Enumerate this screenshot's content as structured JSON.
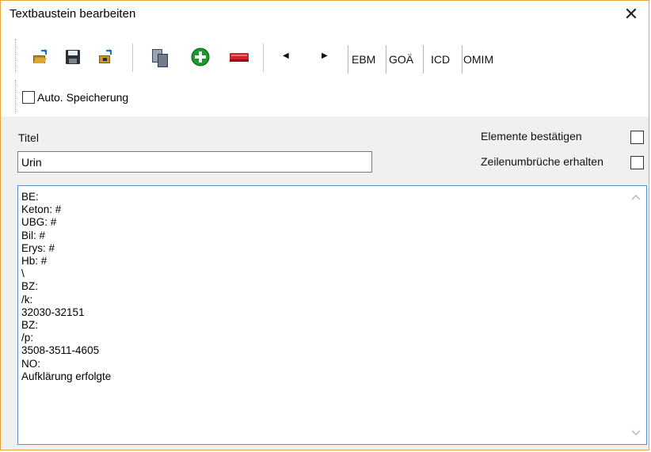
{
  "window": {
    "title": "Textbaustein bearbeiten",
    "close_glyph": "✕"
  },
  "toolbar": {
    "icons": [
      "open-folder-icon",
      "save-icon",
      "export-folder-icon",
      "copy-icon",
      "add-icon",
      "remove-icon"
    ],
    "nav_prev": "◀",
    "nav_next": "▶",
    "labels": [
      "EBM",
      "GOÄ",
      "ICD",
      "OMIM"
    ],
    "auto_save_label": "Auto. Speicherung",
    "auto_save_checked": false
  },
  "form": {
    "title_label": "Titel",
    "title_value": "Urin",
    "confirm_elements_label": "Elemente bestätigen",
    "confirm_elements_checked": false,
    "keep_linebreaks_label": "Zeilenumbrüche erhalten",
    "keep_linebreaks_checked": false
  },
  "text_lines": [
    "BE:",
    "Keton: #",
    "UBG: #",
    "Bil: #",
    "Erys: #",
    "Hb: #",
    "\\",
    "BZ:",
    "/k:",
    "32030-32151",
    "BZ:",
    "/p:",
    "3508-3511-4605",
    "NO:",
    "Aufklärung erfolgte"
  ],
  "colors": {
    "window_border": "#e8a33d",
    "textarea_border": "#5a8fd0",
    "add_green": "#1a9a2c",
    "remove_red": "#d0212b"
  }
}
